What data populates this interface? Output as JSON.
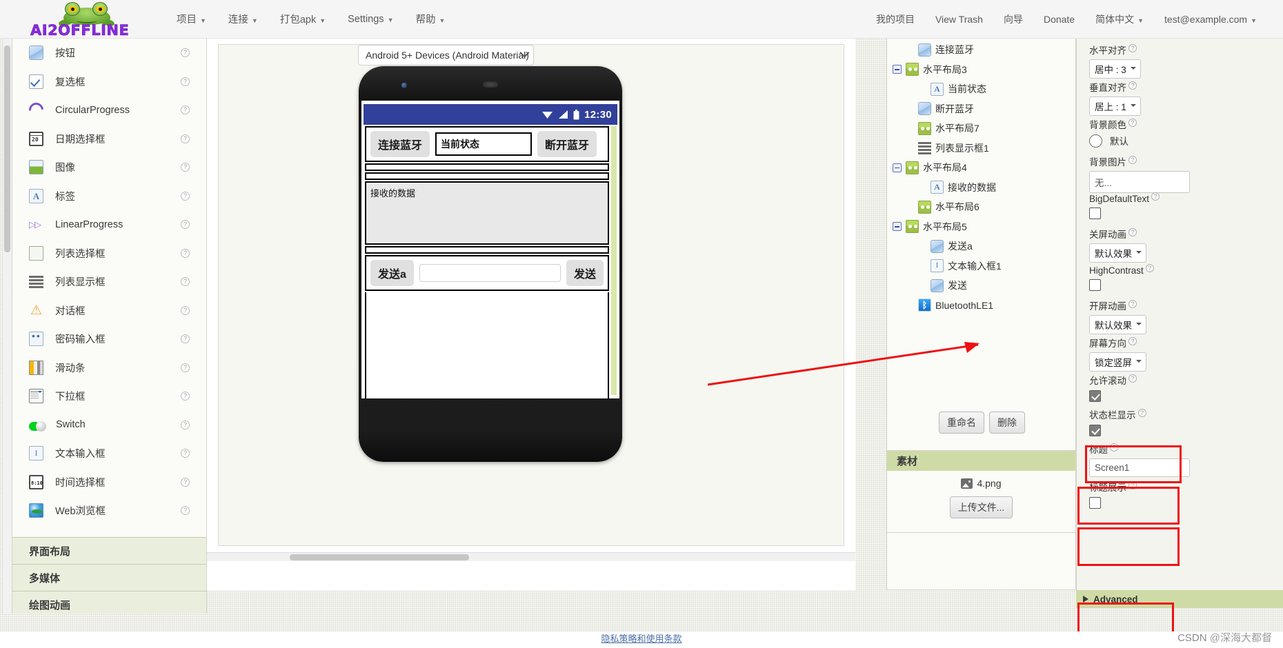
{
  "header": {
    "logo_text": "AI2OFFLINE",
    "nav_left": [
      {
        "label": "项目",
        "caret": true
      },
      {
        "label": "连接",
        "caret": true
      },
      {
        "label": "打包apk",
        "caret": true
      },
      {
        "label": "Settings",
        "caret": true
      },
      {
        "label": "帮助",
        "caret": true
      }
    ],
    "nav_right": [
      {
        "label": "我的项目",
        "caret": false
      },
      {
        "label": "View Trash",
        "caret": false
      },
      {
        "label": "向导",
        "caret": false
      },
      {
        "label": "Donate",
        "caret": false
      },
      {
        "label": "简体中文",
        "caret": true
      },
      {
        "label": "test@example.com",
        "caret": true
      }
    ]
  },
  "palette": {
    "items": [
      {
        "label": "按钮",
        "icon": "button-icon",
        "help": "?"
      },
      {
        "label": "复选框",
        "icon": "checkbox-icon",
        "help": "?"
      },
      {
        "label": "CircularProgress",
        "icon": "circular-progress-icon",
        "help": "?"
      },
      {
        "label": "日期选择框",
        "icon": "date-picker-icon",
        "help": "?"
      },
      {
        "label": "图像",
        "icon": "image-icon",
        "help": "?"
      },
      {
        "label": "标签",
        "icon": "label-icon",
        "help": "?"
      },
      {
        "label": "LinearProgress",
        "icon": "linear-progress-icon",
        "help": "?"
      },
      {
        "label": "列表选择框",
        "icon": "list-picker-icon",
        "help": "?"
      },
      {
        "label": "列表显示框",
        "icon": "list-view-icon",
        "help": "?"
      },
      {
        "label": "对话框",
        "icon": "dialog-icon",
        "help": "?"
      },
      {
        "label": "密码输入框",
        "icon": "password-box-icon",
        "help": "?"
      },
      {
        "label": "滑动条",
        "icon": "slider-icon",
        "help": "?"
      },
      {
        "label": "下拉框",
        "icon": "spinner-icon",
        "help": "?"
      },
      {
        "label": "Switch",
        "icon": "switch-icon",
        "help": "?"
      },
      {
        "label": "文本输入框",
        "icon": "textbox-icon",
        "help": "?"
      },
      {
        "label": "时间选择框",
        "icon": "time-picker-icon",
        "help": "?"
      },
      {
        "label": "Web浏览框",
        "icon": "web-viewer-icon",
        "help": "?"
      }
    ],
    "sections": [
      {
        "label": "界面布局"
      },
      {
        "label": "多媒体"
      },
      {
        "label": "绘图动画"
      }
    ]
  },
  "viewer": {
    "device_select": "Android 5+ Devices (Android Material)",
    "phone": {
      "status_time": "12:30",
      "status_icons": [
        "wifi-icon",
        "signal-icon",
        "battery-icon"
      ],
      "rows": {
        "connect_button": "连接蓝牙",
        "status_field": "当前状态",
        "disconnect_button": "断开蓝牙",
        "received_listbox": "接收的数据",
        "send_a_button": "发送a",
        "send_input": "",
        "send_button": "发送"
      }
    }
  },
  "tree": {
    "items": [
      {
        "label": "连接蓝牙",
        "icon": "button-icon",
        "indent": 2,
        "toggle": "none"
      },
      {
        "label": "水平布局3",
        "icon": "hlayout-icon",
        "indent": 1,
        "toggle": "minus"
      },
      {
        "label": "当前状态",
        "icon": "label-icon",
        "indent": 3,
        "toggle": "none"
      },
      {
        "label": "断开蓝牙",
        "icon": "button-icon",
        "indent": 2,
        "toggle": "none"
      },
      {
        "label": "水平布局7",
        "icon": "hlayout-icon",
        "indent": 2,
        "toggle": "none"
      },
      {
        "label": "列表显示框1",
        "icon": "list-view-icon",
        "indent": 2,
        "toggle": "none"
      },
      {
        "label": "水平布局4",
        "icon": "hlayout-icon",
        "indent": 1,
        "toggle": "minus"
      },
      {
        "label": "接收的数据",
        "icon": "label-icon",
        "indent": 3,
        "toggle": "none"
      },
      {
        "label": "水平布局6",
        "icon": "hlayout-icon",
        "indent": 2,
        "toggle": "none"
      },
      {
        "label": "水平布局5",
        "icon": "hlayout-icon",
        "indent": 1,
        "toggle": "minus"
      },
      {
        "label": "发送a",
        "icon": "button-icon",
        "indent": 3,
        "toggle": "none"
      },
      {
        "label": "文本输入框1",
        "icon": "textbox-icon",
        "indent": 3,
        "toggle": "none"
      },
      {
        "label": "发送",
        "icon": "button-icon",
        "indent": 3,
        "toggle": "none"
      },
      {
        "label": "BluetoothLE1",
        "icon": "bluetooth-icon",
        "indent": 2,
        "toggle": "none"
      }
    ],
    "rename_button": "重命名",
    "delete_button": "删除"
  },
  "assets": {
    "title": "素材",
    "files": [
      {
        "name": "4.png",
        "icon": "image-file-icon"
      }
    ],
    "upload_button": "上传文件..."
  },
  "properties": {
    "items": [
      {
        "name": "h-align",
        "label": "水平对齐",
        "type": "select",
        "value": "居中 : 3"
      },
      {
        "name": "v-align",
        "label": "垂直对齐",
        "type": "select",
        "value": "居上 : 1"
      },
      {
        "name": "bg-color",
        "label": "背景颜色",
        "type": "color",
        "value": "默认"
      },
      {
        "name": "bg-image",
        "label": "背景图片",
        "type": "input",
        "value": "无..."
      },
      {
        "name": "big-text",
        "label": "BigDefaultText",
        "type": "check",
        "value": "off"
      },
      {
        "name": "close-anim",
        "label": "关屏动画",
        "type": "select",
        "value": "默认效果"
      },
      {
        "name": "high-contrast",
        "label": "HighContrast",
        "type": "check",
        "value": "off"
      },
      {
        "name": "open-anim",
        "label": "开屏动画",
        "type": "select",
        "value": "默认效果"
      },
      {
        "name": "orientation",
        "label": "屏幕方向",
        "type": "select",
        "value": "锁定竖屏",
        "highlighted": true
      },
      {
        "name": "scrollable",
        "label": "允许滚动",
        "type": "check",
        "value": "on",
        "highlighted": true
      },
      {
        "name": "statusbar",
        "label": "状态栏显示",
        "type": "check",
        "value": "on",
        "highlighted": true
      },
      {
        "name": "title",
        "label": "标题",
        "type": "input",
        "value": "Screen1"
      },
      {
        "name": "title-visible",
        "label": "标题展示",
        "type": "check",
        "value": "off",
        "highlighted": true
      }
    ],
    "advanced_label": "Advanced",
    "help_glyph": "?"
  },
  "footer": {
    "link": "隐私策略和使用条款",
    "watermark_prefix": "CSDN ",
    "watermark_text": "@深海大都督"
  }
}
